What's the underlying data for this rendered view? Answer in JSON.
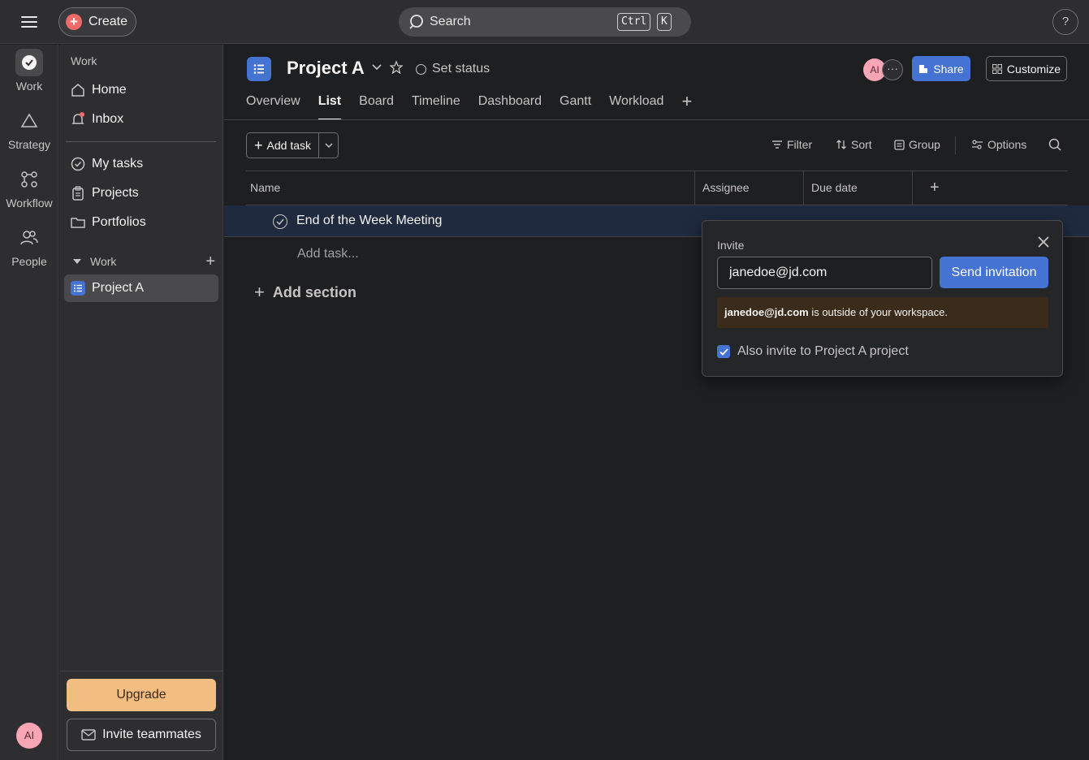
{
  "topbar": {
    "create_label": "Create",
    "search_placeholder": "Search",
    "shortcut_key1": "Ctrl",
    "shortcut_key2": "K",
    "help_label": "?"
  },
  "rail": {
    "items": [
      {
        "label": "Work",
        "icon": "check-circle-icon"
      },
      {
        "label": "Strategy",
        "icon": "triangle-icon"
      },
      {
        "label": "Workflow",
        "icon": "workflow-icon"
      },
      {
        "label": "People",
        "icon": "people-icon"
      }
    ],
    "avatar_initials": "AI"
  },
  "sidebar": {
    "section_label": "Work",
    "items": [
      {
        "label": "Home",
        "icon": "home-icon"
      },
      {
        "label": "Inbox",
        "icon": "bell-icon"
      },
      {
        "label": "My tasks",
        "icon": "check-circle-icon"
      },
      {
        "label": "Projects",
        "icon": "clipboard-icon"
      },
      {
        "label": "Portfolios",
        "icon": "folder-icon"
      }
    ],
    "team_section": "Work",
    "project_item": "Project A",
    "upgrade_label": "Upgrade",
    "invite_label": "Invite teammates"
  },
  "project": {
    "title": "Project A",
    "set_status": "Set status",
    "avatar_initials": "AI",
    "more_label": "···",
    "share_label": "Share",
    "customize_label": "Customize",
    "tabs": [
      "Overview",
      "List",
      "Board",
      "Timeline",
      "Dashboard",
      "Gantt",
      "Workload"
    ],
    "active_tab": "List",
    "add_tab": "+"
  },
  "toolbar": {
    "add_task": "Add task",
    "filter": "Filter",
    "sort": "Sort",
    "group": "Group",
    "options": "Options"
  },
  "table": {
    "columns": [
      "Name",
      "Assignee",
      "Due date"
    ],
    "add_column": "+",
    "rows": [
      {
        "name": "End of the Week Meeting"
      }
    ],
    "add_task_link": "Add task...",
    "add_section": "Add section"
  },
  "invite_popover": {
    "title": "Invite",
    "email_value": "janedoe@jd.com",
    "send_label": "Send invitation",
    "warning_email": "janedoe@jd.com",
    "warning_text": " is outside of your workspace.",
    "also_invite_label": "Also invite to Project A project",
    "also_invite_checked": true
  },
  "colors": {
    "accent": "#4573d2",
    "create": "#f06a6a",
    "upgrade": "#f1bd80",
    "warning_bg": "#3a2b1a"
  }
}
